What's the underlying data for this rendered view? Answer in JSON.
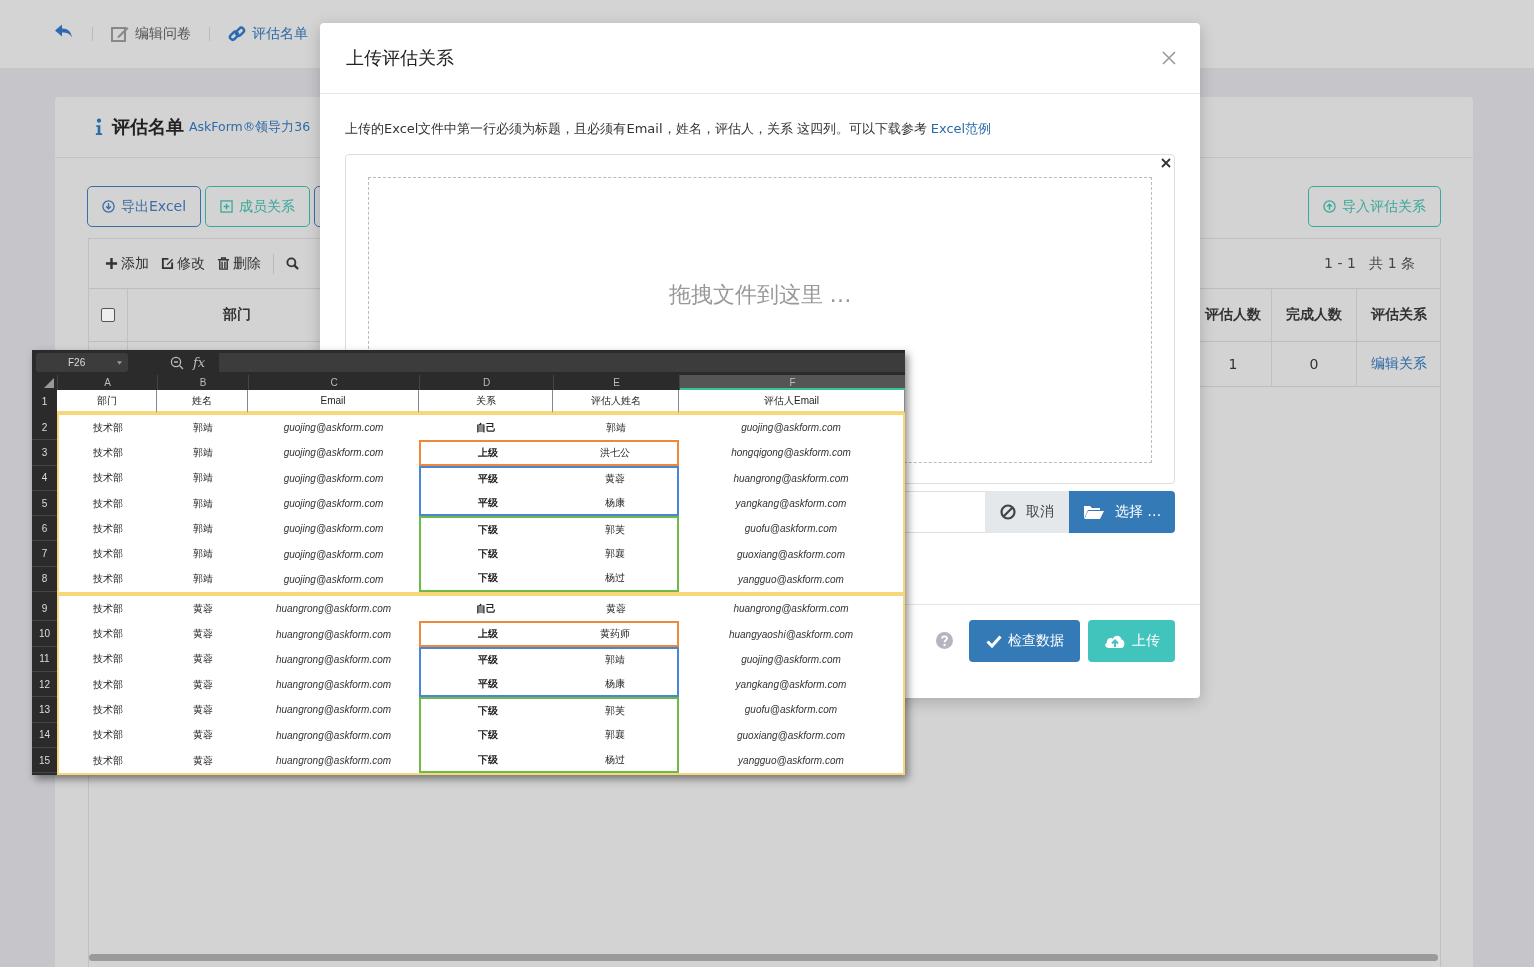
{
  "topbar": {
    "items": [
      {
        "label": "编辑问卷",
        "kind": "edit",
        "selected": false
      },
      {
        "label": "评估名单",
        "kind": "link",
        "selected": true
      }
    ]
  },
  "card": {
    "title": "评估名单",
    "subtitle": "AskForm®领导力36",
    "actions": [
      {
        "label": "导出Excel",
        "kind": "export"
      },
      {
        "label": "成员关系",
        "kind": "members"
      }
    ],
    "import_button": "导入评估关系",
    "tools": [
      {
        "label": "添加",
        "kind": "add"
      },
      {
        "label": "修改",
        "kind": "edit"
      },
      {
        "label": "删除",
        "kind": "delete"
      }
    ],
    "pagination": "1 - 1   共 1 条",
    "select_all": {
      "checked": false
    },
    "columns": [
      "部门",
      "评估人数",
      "完成人数",
      "评估关系"
    ],
    "row": {
      "count": "1",
      "done": "0",
      "action": "编辑关系"
    }
  },
  "modal": {
    "title": "上传评估关系",
    "note": "上传的Excel文件中第一行必须为标题，且必须有Email，姓名，评估人，关系 这四列。可以下载参考",
    "note_link": "Excel范例",
    "dropzone": "拖拽文件到这里 …",
    "cancel": "取消",
    "browse": "选择 …",
    "check": "检查数据",
    "upload": "上传"
  },
  "spreadsheet": {
    "cell_ref": "F26",
    "fx": "fx",
    "columns": [
      {
        "letter": "A",
        "selected": false
      },
      {
        "letter": "B",
        "selected": false
      },
      {
        "letter": "C",
        "selected": false
      },
      {
        "letter": "D",
        "selected": false
      },
      {
        "letter": "E",
        "selected": false
      },
      {
        "letter": "F",
        "selected": true
      }
    ],
    "header_row": {
      "number": "1",
      "cells": [
        "部门",
        "姓名",
        "Email",
        "关系",
        "评估人姓名",
        "评估人Email"
      ]
    },
    "groups": [
      {
        "rows": [
          {
            "number": "2",
            "cells": [
              "技术部",
              "郭靖",
              "guojing@askform.com",
              "自己",
              "郭靖",
              "guojing@askform.com"
            ]
          },
          {
            "number": "3",
            "color": "#f0883a",
            "cells": [
              "技术部",
              "郭靖",
              "guojing@askform.com",
              "上级",
              "洪七公",
              "hongqigong@askform.com"
            ]
          },
          {
            "number": "4",
            "color": "#4a86d8",
            "cells": [
              "技术部",
              "郭靖",
              "guojing@askform.com",
              "平级",
              "黄蓉",
              "huangrong@askform.com"
            ]
          },
          {
            "number": "5",
            "color": "#4a86d8",
            "cells": [
              "技术部",
              "郭靖",
              "guojing@askform.com",
              "平级",
              "杨康",
              "yangkang@askform.com"
            ]
          },
          {
            "number": "6",
            "color": "#6cbb4a",
            "cells": [
              "技术部",
              "郭靖",
              "guojing@askform.com",
              "下级",
              "郭芙",
              "guofu@askform.com"
            ]
          },
          {
            "number": "7",
            "color": "#6cbb4a",
            "cells": [
              "技术部",
              "郭靖",
              "guojing@askform.com",
              "下级",
              "郭襄",
              "guoxiang@askform.com"
            ]
          },
          {
            "number": "8",
            "color": "#6cbb4a",
            "cells": [
              "技术部",
              "郭靖",
              "guojing@askform.com",
              "下级",
              "杨过",
              "yangguo@askform.com"
            ]
          }
        ]
      },
      {
        "rows": [
          {
            "number": "9",
            "cells": [
              "技术部",
              "黄蓉",
              "huangrong@askform.com",
              "自己",
              "黄蓉",
              "huangrong@askform.com"
            ]
          },
          {
            "number": "10",
            "color": "#f0883a",
            "cells": [
              "技术部",
              "黄蓉",
              "huangrong@askform.com",
              "上级",
              "黄药师",
              "huangyaoshi@askform.com"
            ]
          },
          {
            "number": "11",
            "color": "#4a86d8",
            "cells": [
              "技术部",
              "黄蓉",
              "huangrong@askform.com",
              "平级",
              "郭靖",
              "guojing@askform.com"
            ]
          },
          {
            "number": "12",
            "color": "#4a86d8",
            "cells": [
              "技术部",
              "黄蓉",
              "huangrong@askform.com",
              "平级",
              "杨康",
              "yangkang@askform.com"
            ]
          },
          {
            "number": "13",
            "color": "#6cbb4a",
            "cells": [
              "技术部",
              "黄蓉",
              "huangrong@askform.com",
              "下级",
              "郭芙",
              "guofu@askform.com"
            ]
          },
          {
            "number": "14",
            "color": "#6cbb4a",
            "cells": [
              "技术部",
              "黄蓉",
              "huangrong@askform.com",
              "下级",
              "郭襄",
              "guoxiang@askform.com"
            ]
          },
          {
            "number": "15",
            "color": "#6cbb4a",
            "cells": [
              "技术部",
              "黄蓉",
              "huangrong@askform.com",
              "下级",
              "杨过",
              "yangguo@askform.com"
            ]
          }
        ]
      }
    ]
  }
}
